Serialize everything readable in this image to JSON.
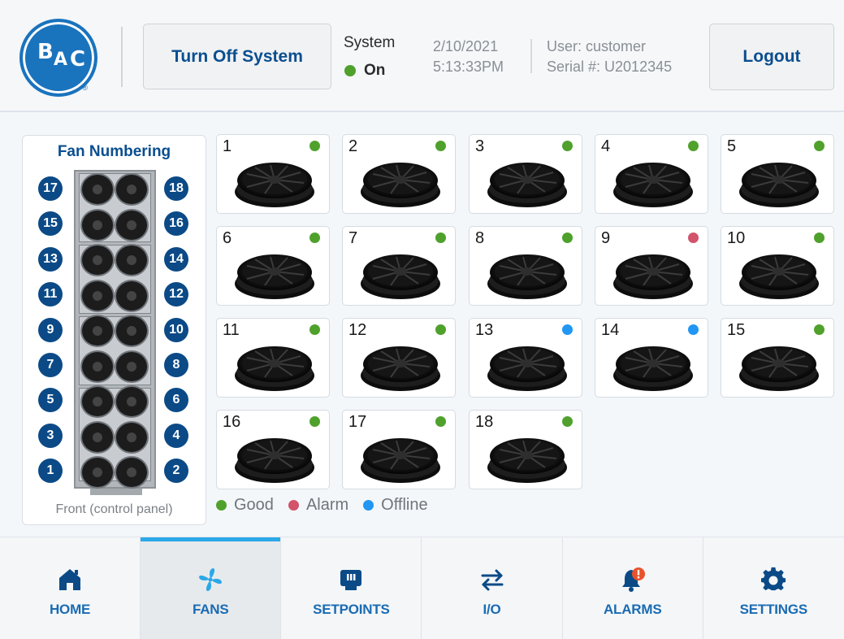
{
  "header": {
    "logo": {
      "text": "BAC",
      "mark": "®"
    },
    "turn_off_button": "Turn Off System",
    "system_label": "System",
    "system_state": "On",
    "date": "2/10/2021",
    "time": "5:13:33PM",
    "user": "User: customer",
    "serial": "Serial #: U2012345",
    "logout_button": "Logout"
  },
  "colors": {
    "brand": "#1a73bd",
    "status_good": "#4fa12c",
    "status_alarm": "#d2536a",
    "status_offline": "#2196f3",
    "active_tab": "#2aa8e8"
  },
  "fan_numbering": {
    "title": "Fan Numbering",
    "front_label": "Front (control panel)",
    "left_numbers": [
      "17",
      "15",
      "13",
      "11",
      "9",
      "7",
      "5",
      "3",
      "1"
    ],
    "right_numbers": [
      "18",
      "16",
      "14",
      "12",
      "10",
      "8",
      "6",
      "4",
      "2"
    ]
  },
  "fans": [
    {
      "number": "1",
      "status": "good"
    },
    {
      "number": "2",
      "status": "good"
    },
    {
      "number": "3",
      "status": "good"
    },
    {
      "number": "4",
      "status": "good"
    },
    {
      "number": "5",
      "status": "good"
    },
    {
      "number": "6",
      "status": "good"
    },
    {
      "number": "7",
      "status": "good"
    },
    {
      "number": "8",
      "status": "good"
    },
    {
      "number": "9",
      "status": "alarm"
    },
    {
      "number": "10",
      "status": "good"
    },
    {
      "number": "11",
      "status": "good"
    },
    {
      "number": "12",
      "status": "good"
    },
    {
      "number": "13",
      "status": "offline"
    },
    {
      "number": "14",
      "status": "offline"
    },
    {
      "number": "15",
      "status": "good"
    },
    {
      "number": "16",
      "status": "good"
    },
    {
      "number": "17",
      "status": "good"
    },
    {
      "number": "18",
      "status": "good"
    }
  ],
  "legend": [
    {
      "label": "Good",
      "status": "good"
    },
    {
      "label": "Alarm",
      "status": "alarm"
    },
    {
      "label": "Offline",
      "status": "offline"
    }
  ],
  "nav": [
    {
      "label": "HOME",
      "icon": "home-icon",
      "active": false
    },
    {
      "label": "FANS",
      "icon": "fan-icon",
      "active": true
    },
    {
      "label": "SETPOINTS",
      "icon": "setpoints-icon",
      "active": false
    },
    {
      "label": "I/O",
      "icon": "io-arrows-icon",
      "active": false
    },
    {
      "label": "ALARMS",
      "icon": "alarm-bell-icon",
      "active": false
    },
    {
      "label": "SETTINGS",
      "icon": "gear-icon",
      "active": false
    }
  ]
}
